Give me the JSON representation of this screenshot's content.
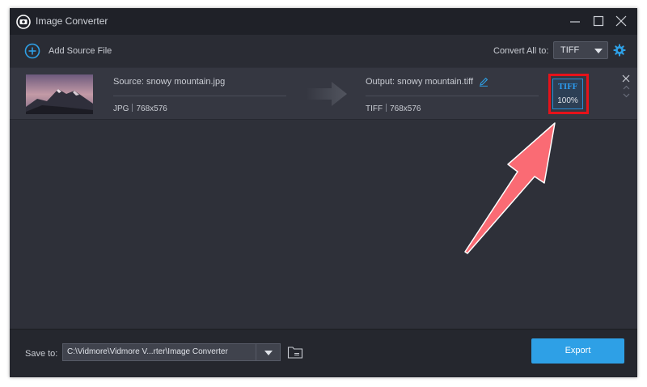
{
  "titlebar": {
    "title": "Image Converter",
    "logo_icon": "converter-logo-icon",
    "minimize_icon": "minimize-icon",
    "maximize_icon": "maximize-icon",
    "close_icon": "close-icon"
  },
  "toolbar": {
    "add_label": "Add Source File",
    "add_icon": "plus-circle-icon",
    "convert_all_label": "Convert All to:",
    "convert_all_value": "TIFF",
    "settings_icon": "gear-icon"
  },
  "file": {
    "source_name": "Source: snowy mountain.jpg",
    "source_format": "JPG",
    "source_size": "768x576",
    "output_name": "Output: snowy mountain.tiff",
    "output_format": "TIFF",
    "output_size": "768x576",
    "format_badge": "TIFF",
    "progress_text": "100%",
    "progress": 100
  },
  "footer": {
    "save_label": "Save to:",
    "save_path": "C:\\Vidmore\\Vidmore V...rter\\Image Converter",
    "export_label": "Export"
  },
  "colors": {
    "accent": "#2ea0e6",
    "highlight": "#e6121a",
    "annotation_arrow": "#fa6b74",
    "background": "#2e3039"
  }
}
